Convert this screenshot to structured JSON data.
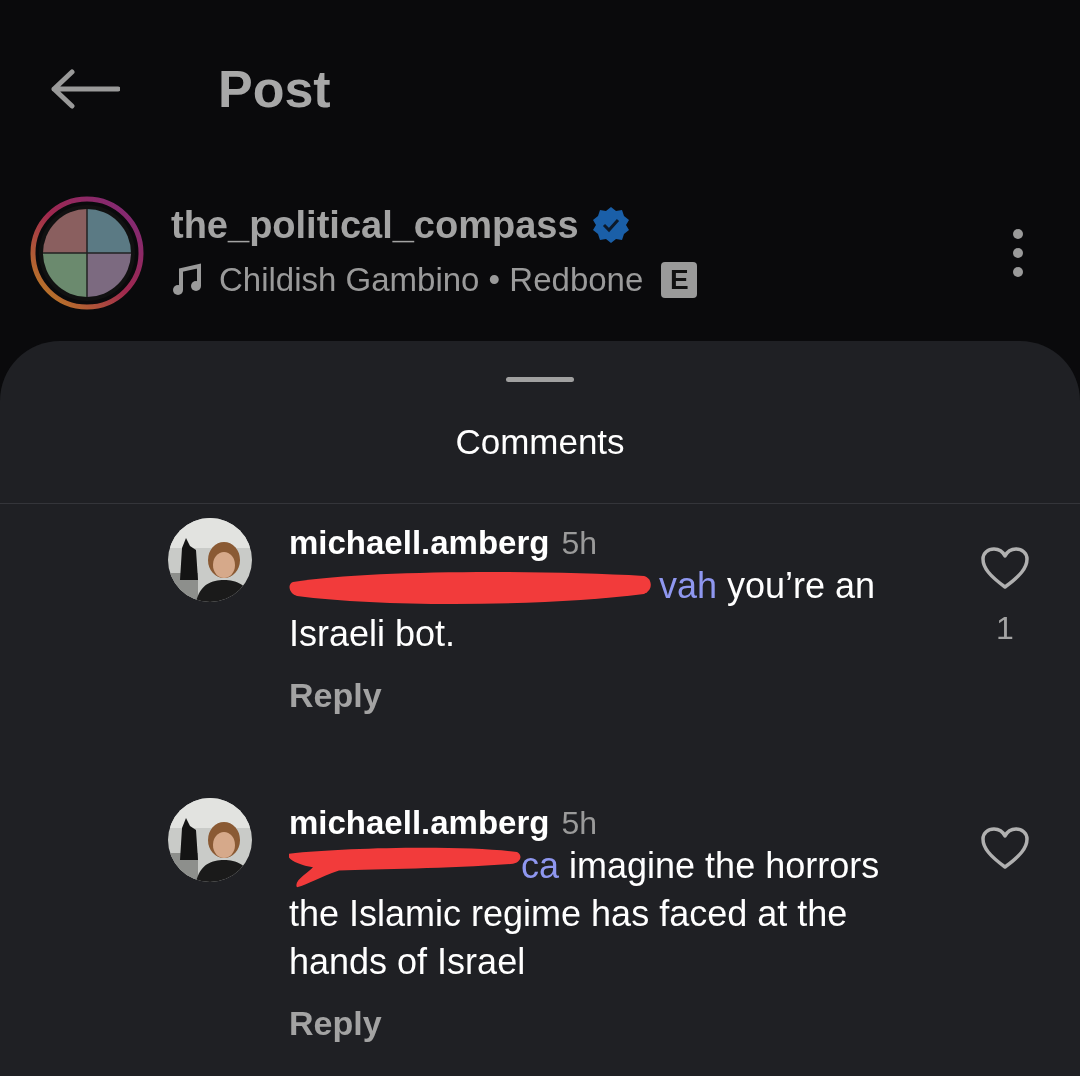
{
  "header": {
    "title": "Post"
  },
  "post": {
    "username": "the_political_compass",
    "verified": true,
    "music": "Childish Gambino • Redbone",
    "explicit_badge": "E"
  },
  "sheet": {
    "title": "Comments"
  },
  "comments": [
    {
      "username": "michaell.amberg",
      "time": "5h",
      "redacted": true,
      "mention": "vah",
      "text": "you’re an Israeli bot.",
      "likes": "1",
      "reply": "Reply"
    },
    {
      "username": "michaell.amberg",
      "time": "5h",
      "redacted": true,
      "mention": "ca",
      "text": "imagine the horrors the Islamic regime has faced at the hands of Israel",
      "reply": "Reply"
    }
  ]
}
